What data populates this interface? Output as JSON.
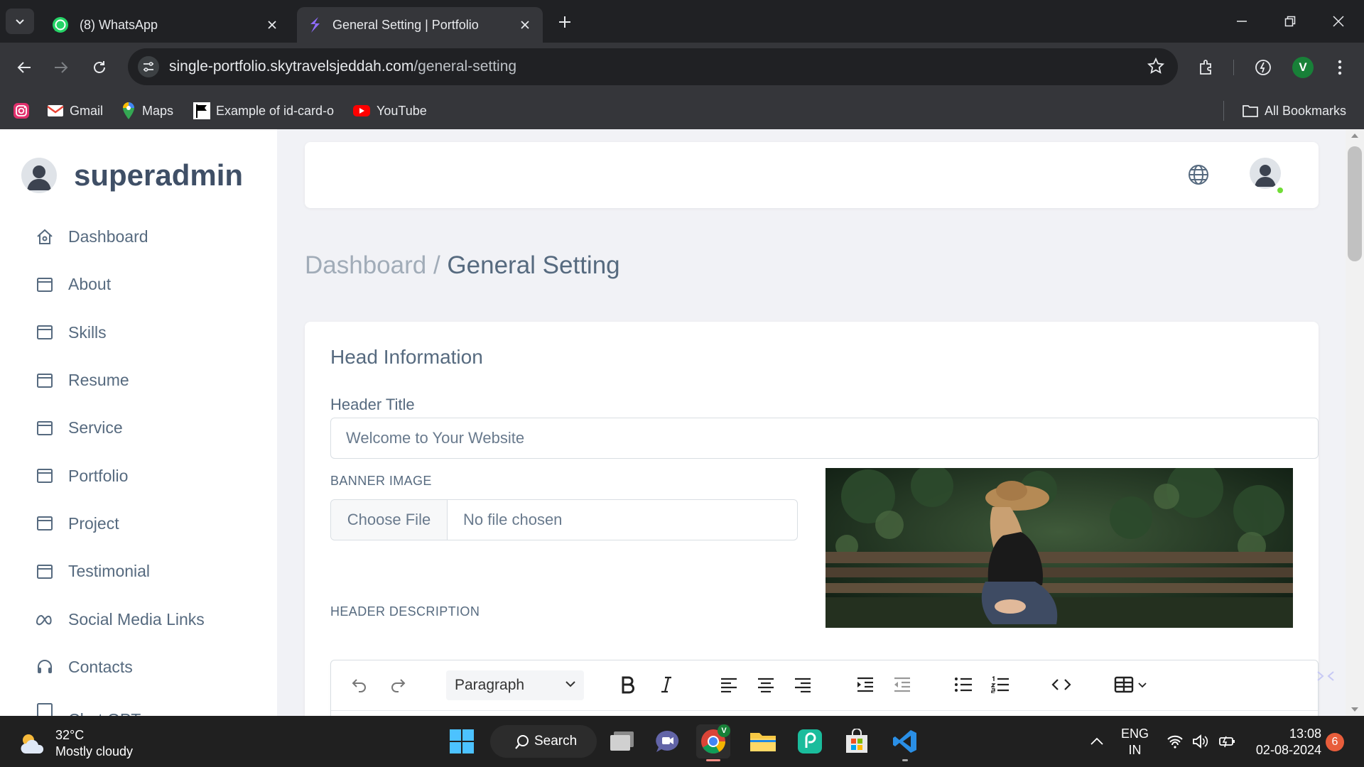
{
  "browser": {
    "tabs": [
      {
        "label": "(8) WhatsApp",
        "active": false,
        "icon": "whatsapp-icon"
      },
      {
        "label": "General Setting | Portfolio",
        "active": true,
        "icon": "portfolio-icon"
      }
    ],
    "url": {
      "host": "single-portfolio.skytravelsjeddah.com",
      "path": "/general-setting"
    },
    "profile_initial": "V",
    "bookmarks": [
      {
        "label": "",
        "icon": "instagram-icon"
      },
      {
        "label": "Gmail",
        "icon": "gmail-icon"
      },
      {
        "label": "Maps",
        "icon": "maps-icon"
      },
      {
        "label": "Example of id-card-o",
        "icon": "flag-icon"
      },
      {
        "label": "YouTube",
        "icon": "youtube-icon"
      }
    ],
    "all_bookmarks": "All Bookmarks"
  },
  "sidebar": {
    "brand": "superadmin",
    "items": [
      {
        "label": "Dashboard",
        "icon": "home-icon"
      },
      {
        "label": "About",
        "icon": "window-icon"
      },
      {
        "label": "Skills",
        "icon": "window-icon"
      },
      {
        "label": "Resume",
        "icon": "window-icon"
      },
      {
        "label": "Service",
        "icon": "window-icon"
      },
      {
        "label": "Portfolio",
        "icon": "window-icon"
      },
      {
        "label": "Project",
        "icon": "window-icon"
      },
      {
        "label": "Testimonial",
        "icon": "window-icon"
      },
      {
        "label": "Social Media Links",
        "icon": "meta-icon"
      },
      {
        "label": "Contacts",
        "icon": "headset-icon"
      }
    ],
    "partial_item": "Chat GPT"
  },
  "breadcrumb": {
    "parent": "Dashboard",
    "separator": " / ",
    "current": "General Setting"
  },
  "form": {
    "section_title": "Head Information",
    "header_title_label": "Header Title",
    "header_title_value": "Welcome to Your Website",
    "banner_label": "BANNER IMAGE",
    "file_button": "Choose File",
    "file_status": "No file chosen",
    "description_label": "HEADER DESCRIPTION",
    "block_format": "Paragraph"
  },
  "taskbar": {
    "temperature": "32°C",
    "weather": "Mostly cloudy",
    "search": "Search",
    "lang_top": "ENG",
    "lang_bottom": "IN",
    "time": "13:08",
    "date": "02-08-2024",
    "notifications": "6"
  },
  "colors": {
    "accent": "#696cff",
    "sidebar_text": "#566a7f",
    "page_bg": "#f1f2f6"
  }
}
